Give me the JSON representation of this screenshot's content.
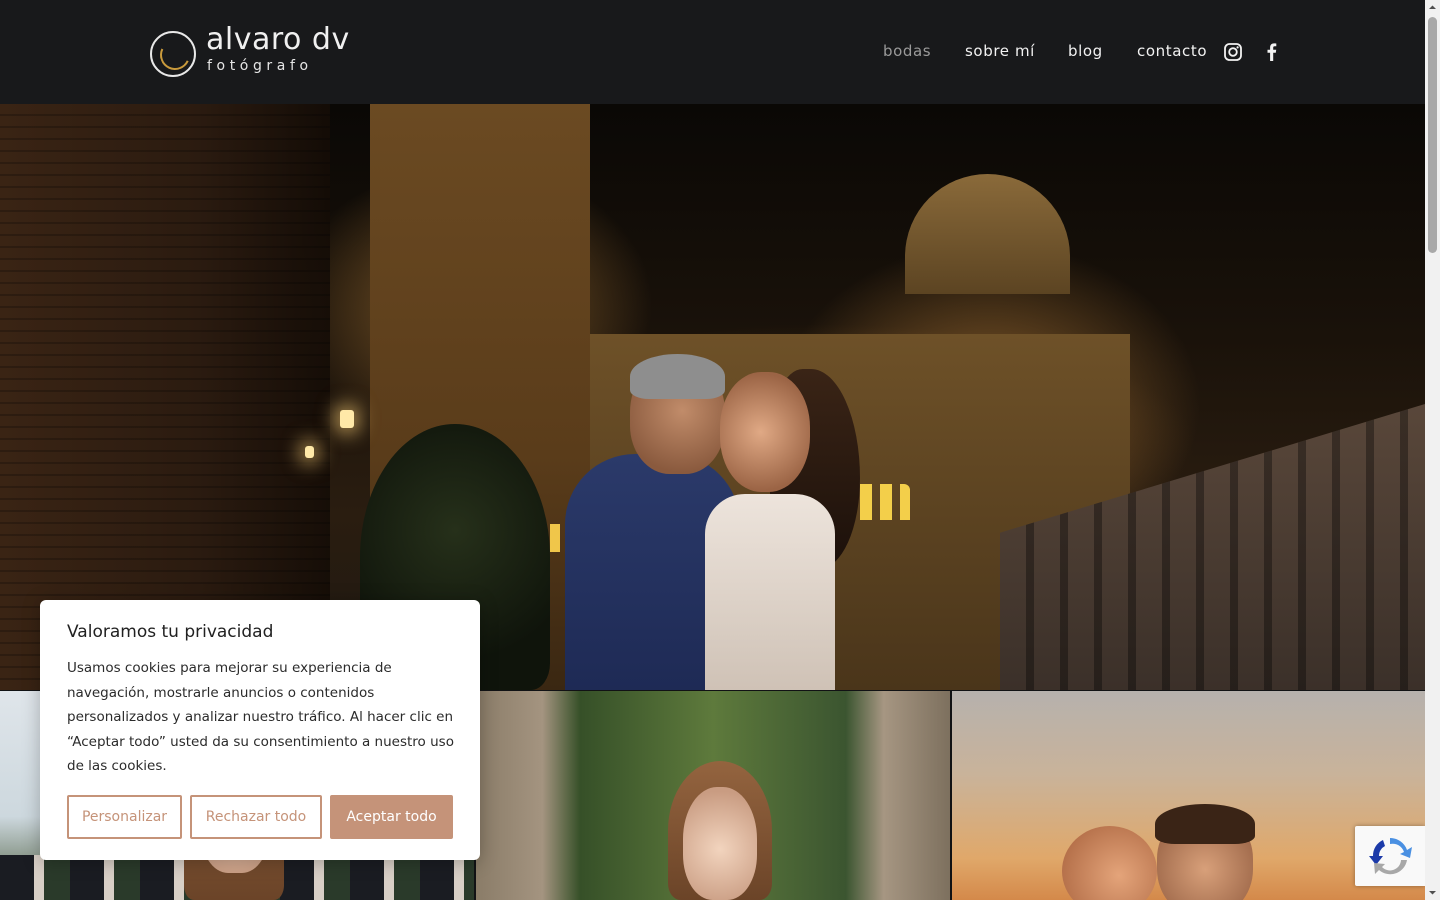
{
  "logo": {
    "name": "alvaro dv",
    "subtitle": "fotógrafo",
    "accent_color": "#c99a3c"
  },
  "nav": {
    "items": [
      {
        "label": "bodas",
        "active": true
      },
      {
        "label": "sobre mí",
        "active": false
      },
      {
        "label": "blog",
        "active": false
      },
      {
        "label": "contacto",
        "active": false
      }
    ],
    "social": [
      "instagram-icon",
      "facebook-icon"
    ]
  },
  "cookie_banner": {
    "title": "Valoramos tu privacidad",
    "text": "Usamos cookies para mejorar su experiencia de navegación, mostrarle anuncios o contenidos personalizados y analizar nuestro tráfico. Al hacer clic en “Aceptar todo” usted da su consentimiento a nuestro uso de las cookies.",
    "customize_label": "Personalizar",
    "reject_label": "Rechazar todo",
    "accept_label": "Aceptar todo",
    "accent_color": "#c59379"
  },
  "recaptcha": {
    "icon": "recaptcha-icon"
  }
}
